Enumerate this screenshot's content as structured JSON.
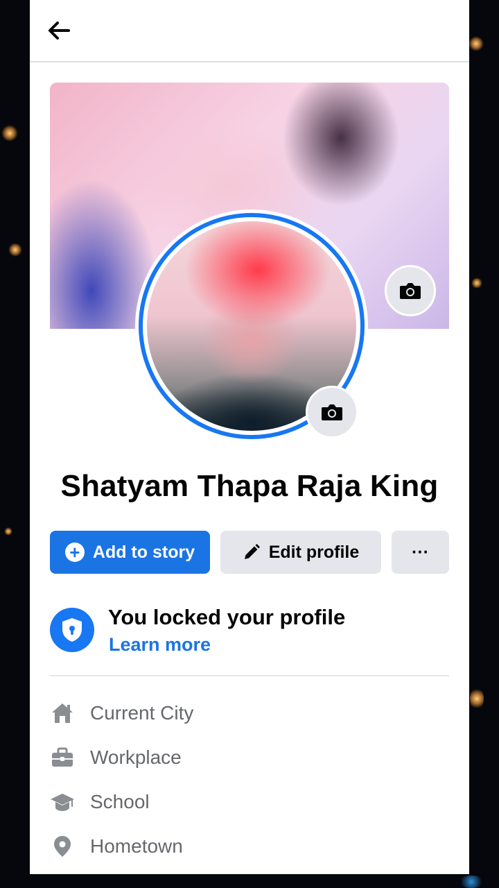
{
  "header": {
    "back_icon": "arrow-left-icon"
  },
  "profile": {
    "name": "Shatyam Thapa Raja King",
    "cover_camera_icon": "camera-icon",
    "avatar_camera_icon": "camera-icon",
    "ring_color": "#1877f2"
  },
  "actions": {
    "add_to_story": "Add to story",
    "edit_profile": "Edit profile",
    "more": "···",
    "primary_color": "#1b74e4",
    "secondary_color": "#e4e6eb"
  },
  "lock_notice": {
    "title": "You locked your profile",
    "link": "Learn more",
    "icon": "shield-lock-icon"
  },
  "intro": {
    "items": [
      {
        "label": "Current City",
        "icon": "home-icon"
      },
      {
        "label": "Workplace",
        "icon": "briefcase-icon"
      },
      {
        "label": "School",
        "icon": "graduation-cap-icon"
      },
      {
        "label": "Hometown",
        "icon": "location-pin-icon"
      }
    ]
  }
}
